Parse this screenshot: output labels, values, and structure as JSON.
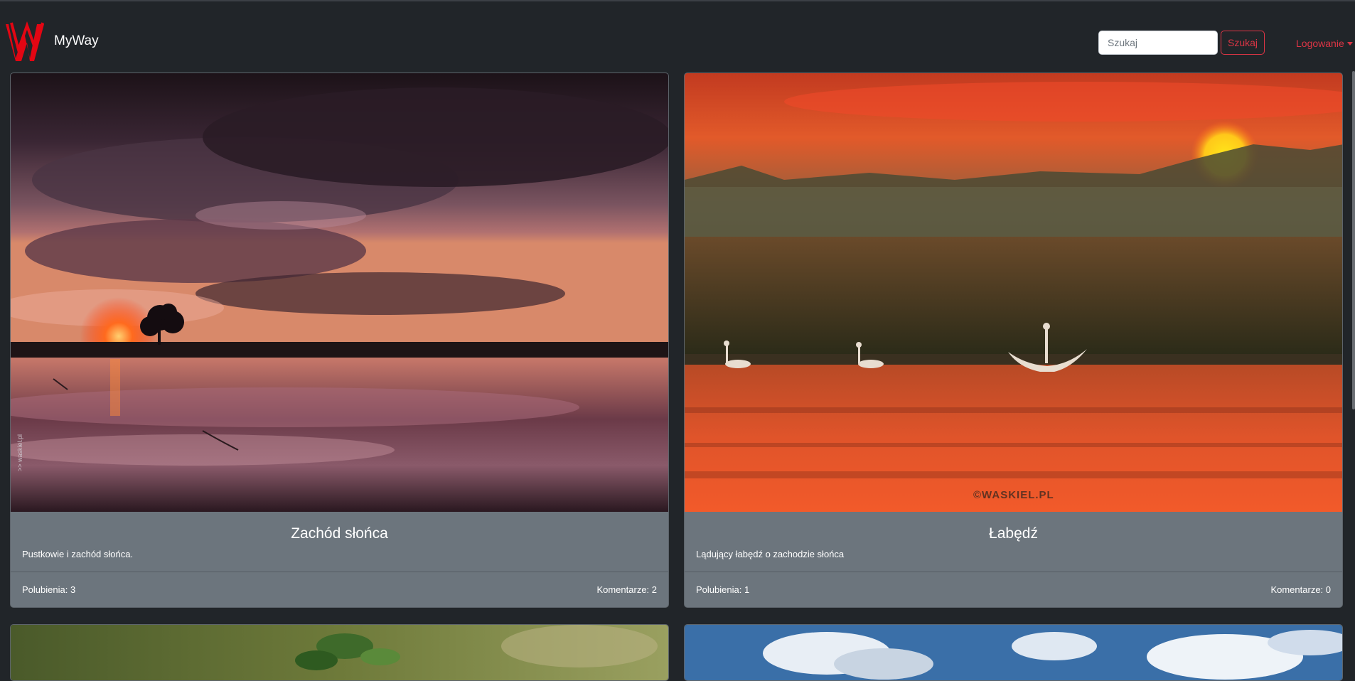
{
  "app": {
    "name": "MyWay"
  },
  "header": {
    "search_placeholder": "Szukaj",
    "search_button": "Szukaj",
    "login_label": "Logowanie"
  },
  "cards": [
    {
      "title": "Zachód słońca",
      "description": "Pustkowie i zachód słońca.",
      "likes": "Polubienia: 3",
      "comments": "Komentarze: 2",
      "image_watermark": ">> waskiel.pl"
    },
    {
      "title": "Łabędź",
      "description": "Lądujący łabędź o zachodzie słońca",
      "likes": "Polubienia: 1",
      "comments": "Komentarze: 0",
      "image_watermark": "©WASKIEL.PL"
    }
  ],
  "colors": {
    "accent": "#dc3545",
    "background": "#212529",
    "card": "#6c757d"
  }
}
